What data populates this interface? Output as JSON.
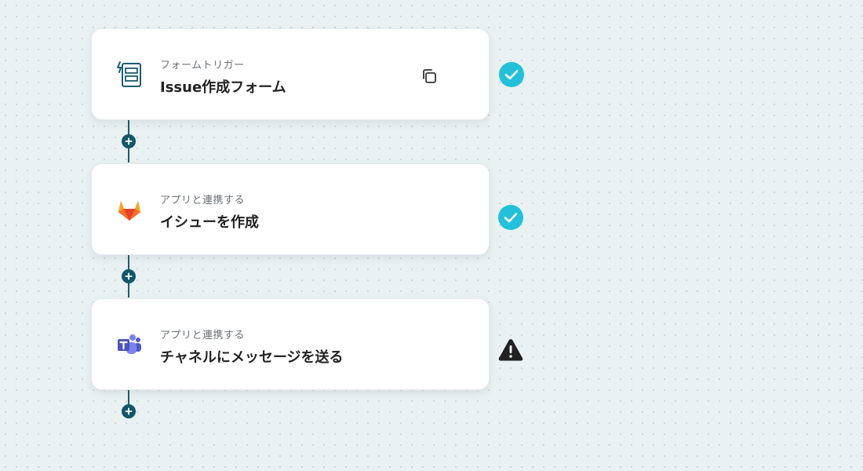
{
  "steps": [
    {
      "subtitle": "フォームトリガー",
      "title": "Issue作成フォーム",
      "icon": "form-trigger-icon",
      "status": "complete"
    },
    {
      "subtitle": "アプリと連携する",
      "title": "イシューを作成",
      "icon": "gitlab-icon",
      "status": "complete"
    },
    {
      "subtitle": "アプリと連携する",
      "title": "チャネルにメッセージを送る",
      "icon": "teams-icon",
      "status": "warning"
    }
  ],
  "colors": {
    "accent": "#11566a",
    "check": "#22c1d9",
    "warning": "#222222",
    "background": "#eaf1f3"
  }
}
